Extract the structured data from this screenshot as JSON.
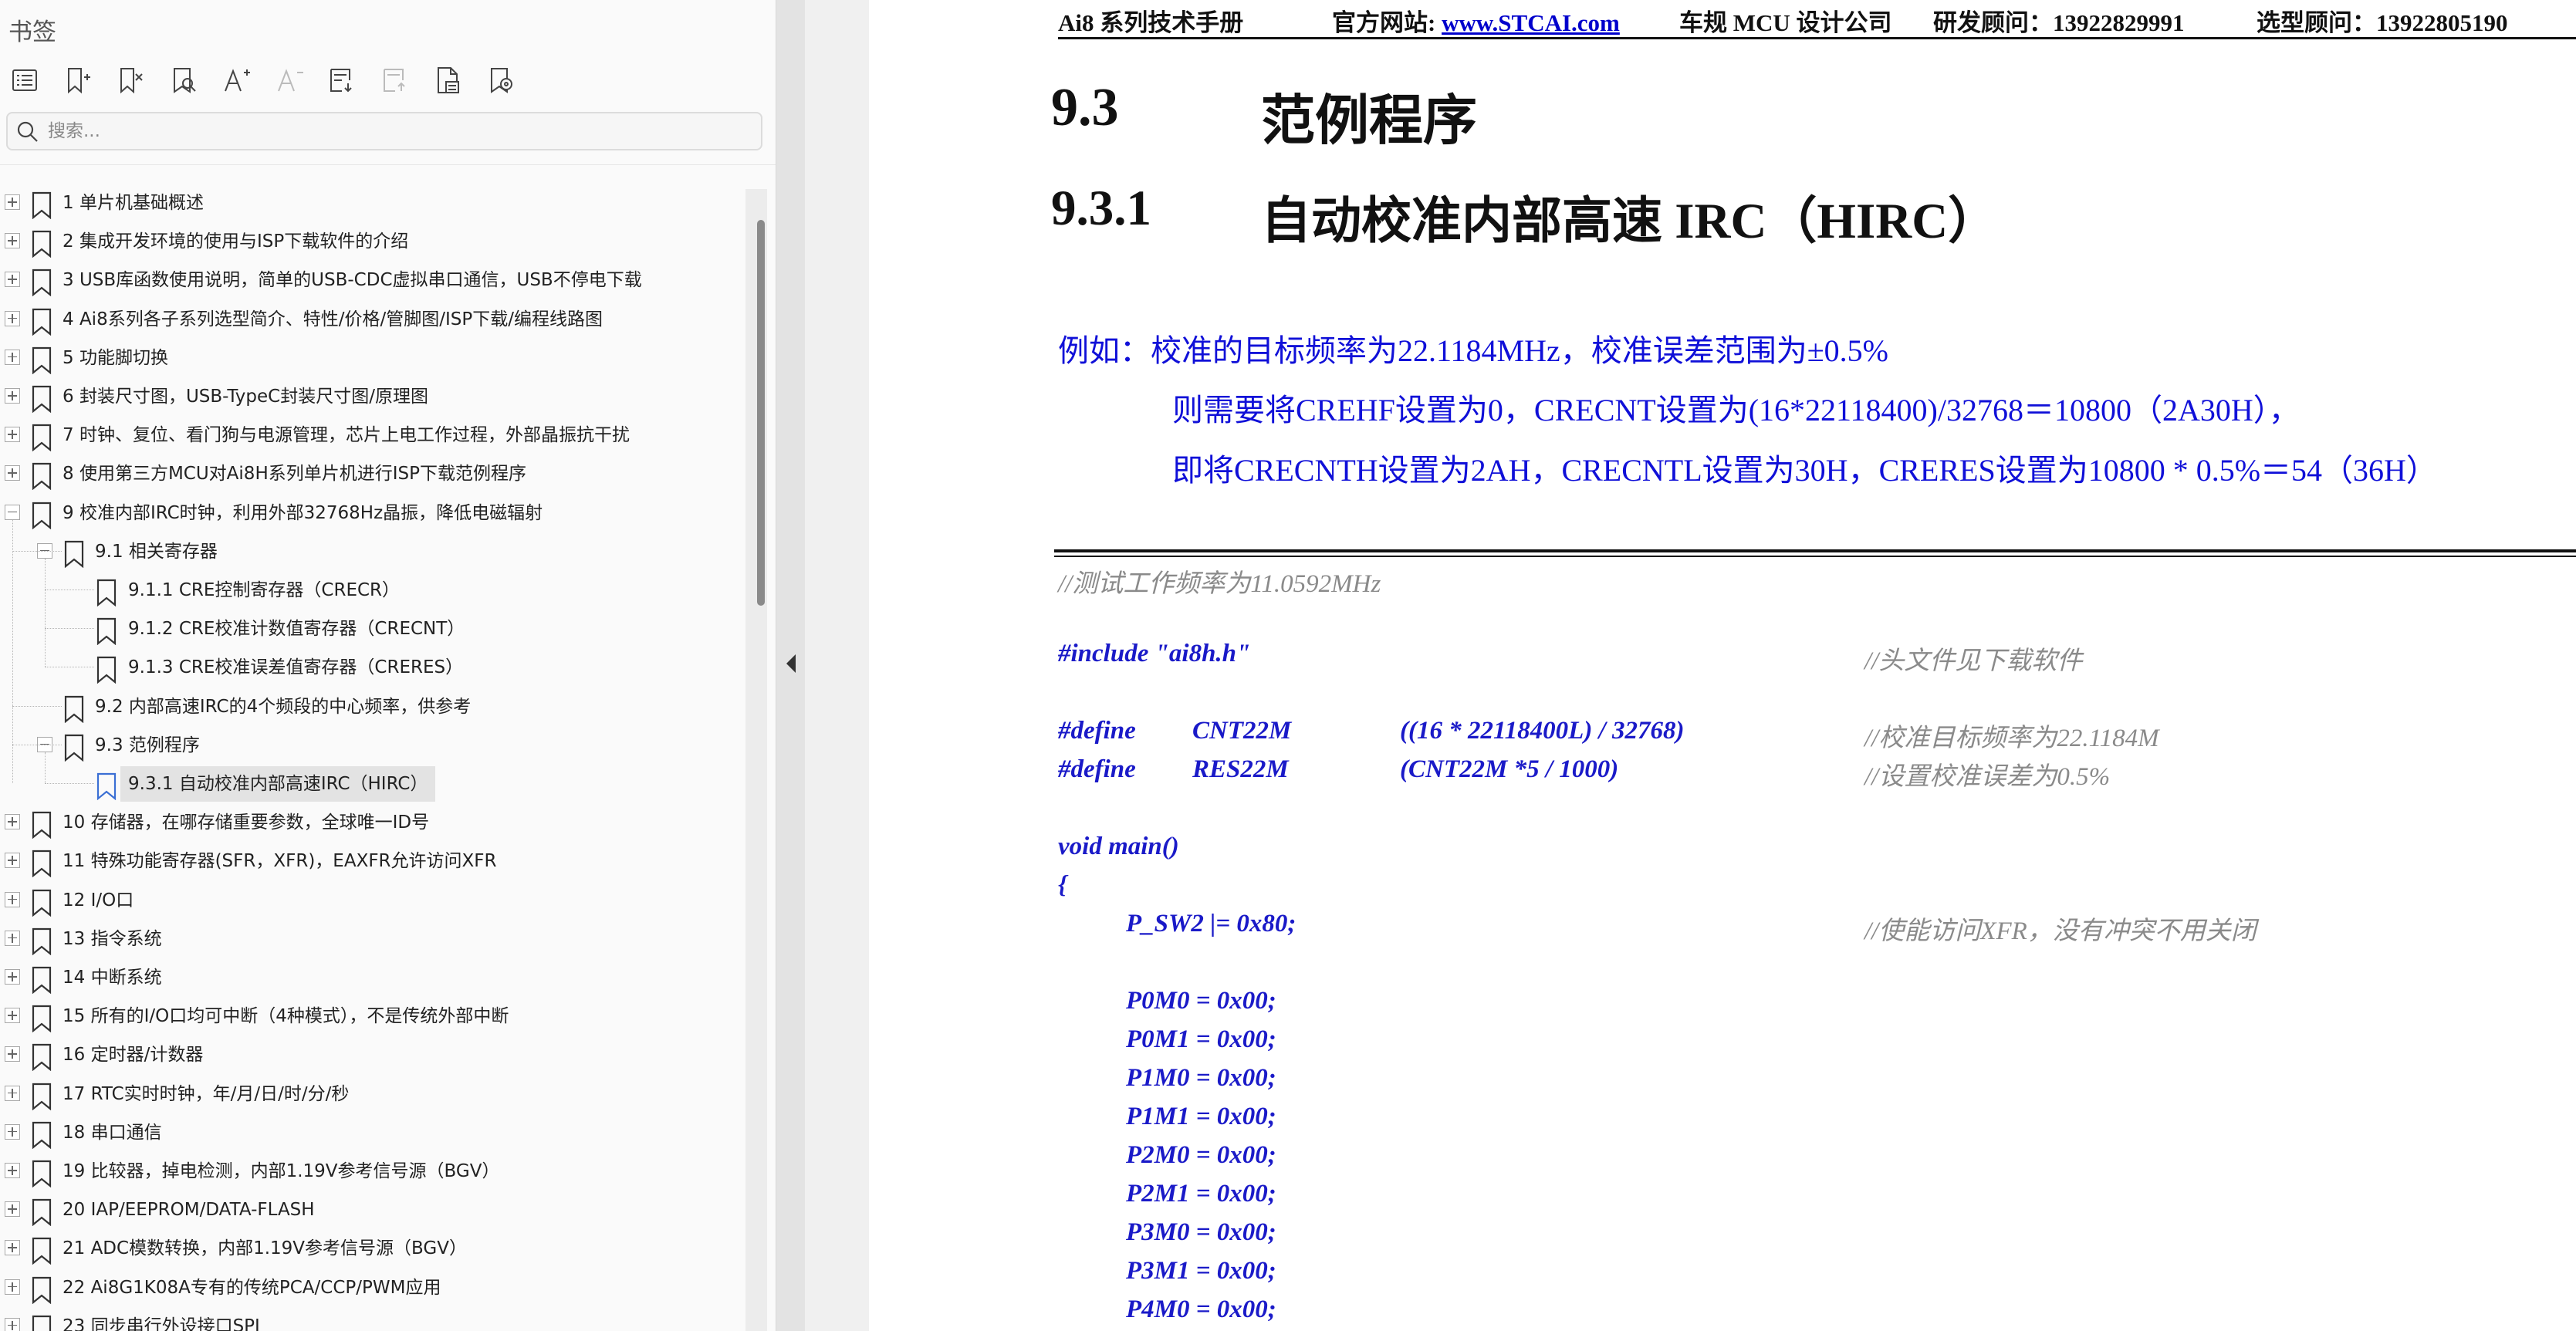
{
  "sidebar": {
    "title": "书签",
    "toolbar_icons": [
      "bookmark-list-icon",
      "add-bookmark-icon",
      "delete-bookmark-icon",
      "find-bookmark-icon",
      "font-increase-icon",
      "font-decrease-icon",
      "expand-all-icon",
      "collapse-all-icon",
      "bookmark-properties-icon",
      "bookmark-locate-icon"
    ],
    "search_placeholder": "搜索...",
    "tree": [
      {
        "label": "1 单片机基础概述",
        "level": 0,
        "expander": "plus"
      },
      {
        "label": "2 集成开发环境的使用与ISP下载软件的介绍",
        "level": 0,
        "expander": "plus"
      },
      {
        "label": "3 USB库函数使用说明，简单的USB-CDC虚拟串口通信，USB不停电下载",
        "level": 0,
        "expander": "plus"
      },
      {
        "label": "4 Ai8系列各子系列选型简介、特性/价格/管脚图/ISP下载/编程线路图",
        "level": 0,
        "expander": "plus"
      },
      {
        "label": "5 功能脚切换",
        "level": 0,
        "expander": "plus"
      },
      {
        "label": "6 封装尺寸图，USB-TypeC封装尺寸图/原理图",
        "level": 0,
        "expander": "plus"
      },
      {
        "label": "7 时钟、复位、看门狗与电源管理，芯片上电工作过程，外部晶振抗干扰",
        "level": 0,
        "expander": "plus"
      },
      {
        "label": "8 使用第三方MCU对Ai8H系列单片机进行ISP下载范例程序",
        "level": 0,
        "expander": "plus"
      },
      {
        "label": "9 校准内部IRC时钟，利用外部32768Hz晶振，降低电磁辐射",
        "level": 0,
        "expander": "minus"
      },
      {
        "label": "9.1 相关寄存器",
        "level": 1,
        "expander": "minus"
      },
      {
        "label": "9.1.1 CRE控制寄存器（CRECR）",
        "level": 2,
        "expander": "none"
      },
      {
        "label": "9.1.2 CRE校准计数值寄存器（CRECNT）",
        "level": 2,
        "expander": "none"
      },
      {
        "label": "9.1.3 CRE校准误差值寄存器（CRERES）",
        "level": 2,
        "expander": "none"
      },
      {
        "label": "9.2 内部高速IRC的4个频段的中心频率，供参考",
        "level": 1,
        "expander": "none"
      },
      {
        "label": "9.3 范例程序",
        "level": 1,
        "expander": "minus"
      },
      {
        "label": "9.3.1 自动校准内部高速IRC（HIRC）",
        "level": 2,
        "expander": "none",
        "selected": true
      },
      {
        "label": "10 存储器，在哪存储重要参数，全球唯一ID号",
        "level": 0,
        "expander": "plus"
      },
      {
        "label": "11 特殊功能寄存器(SFR，XFR)，EAXFR允许访问XFR",
        "level": 0,
        "expander": "plus"
      },
      {
        "label": "12 I/O口",
        "level": 0,
        "expander": "plus"
      },
      {
        "label": "13 指令系统",
        "level": 0,
        "expander": "plus"
      },
      {
        "label": "14 中断系统",
        "level": 0,
        "expander": "plus"
      },
      {
        "label": "15 所有的I/O口均可中断（4种模式），不是传统外部中断",
        "level": 0,
        "expander": "plus"
      },
      {
        "label": "16 定时器/计数器",
        "level": 0,
        "expander": "plus"
      },
      {
        "label": "17 RTC实时时钟，年/月/日/时/分/秒",
        "level": 0,
        "expander": "plus"
      },
      {
        "label": "18 串口通信",
        "level": 0,
        "expander": "plus"
      },
      {
        "label": "19 比较器，掉电检测，内部1.19V参考信号源（BGV）",
        "level": 0,
        "expander": "plus"
      },
      {
        "label": "20 IAP/EEPROM/DATA-FLASH",
        "level": 0,
        "expander": "plus"
      },
      {
        "label": "21 ADC模数转换，内部1.19V参考信号源（BGV）",
        "level": 0,
        "expander": "plus"
      },
      {
        "label": "22 Ai8G1K08A专有的传统PCA/CCP/PWM应用",
        "level": 0,
        "expander": "plus"
      },
      {
        "label": "23 同步串行外设接口SPI",
        "level": 0,
        "expander": "plus"
      }
    ]
  },
  "page": {
    "header": {
      "manual": "Ai8 系列技术手册",
      "site_label": "官方网站: ",
      "site_url": "www.STCAI.com",
      "company": "车规 MCU 设计公司",
      "rd_contact": "研发顾问：13922829991",
      "sales_contact": "选型顾问：13922805190"
    },
    "section_num": "9.3",
    "section_title": "范例程序",
    "subsection_num": "9.3.1",
    "subsection_title": "自动校准内部高速 IRC（HIRC）",
    "example_lines": [
      "例如：校准的目标频率为22.1184MHz，校准误差范围为±0.5%",
      "则需要将CREHF设置为0，CRECNT设置为(16*22118400)/32768＝10800（2A30H），",
      "即将CRECNTH设置为2AH，CRECNTL设置为30H，CRERES设置为10800 * 0.5%＝54（36H）"
    ],
    "code": {
      "comment_freq": "//测试工作频率为11.0592MHz",
      "include": "#include \"ai8h.h\"",
      "include_comment": "//头文件见下载软件",
      "define1": [
        "#define",
        "CNT22M",
        "((16 * 22118400L) / 32768)"
      ],
      "define1_comment": "//校准目标频率为22.1184M",
      "define2": [
        "#define",
        "RES22M",
        "(CNT22M *5 / 1000)"
      ],
      "define2_comment": "//设置校准误差为0.5%",
      "main_sig": "void main()",
      "brace": "{",
      "psw2": "P_SW2 |= 0x80;",
      "psw2_comment": "//使能访问XFR，没有冲突不用关闭",
      "port_lines": [
        "P0M0 = 0x00;",
        "P0M1 = 0x00;",
        "P1M0 = 0x00;",
        "P1M1 = 0x00;",
        "P2M0 = 0x00;",
        "P2M1 = 0x00;",
        "P3M0 = 0x00;",
        "P3M1 = 0x00;",
        "P4M0 = 0x00;"
      ]
    }
  },
  "colors": {
    "code_blue": "#1a1ac8",
    "text_blue": "#1010d8",
    "comment_gray": "#8a8a8a",
    "link": "#0000cc"
  }
}
